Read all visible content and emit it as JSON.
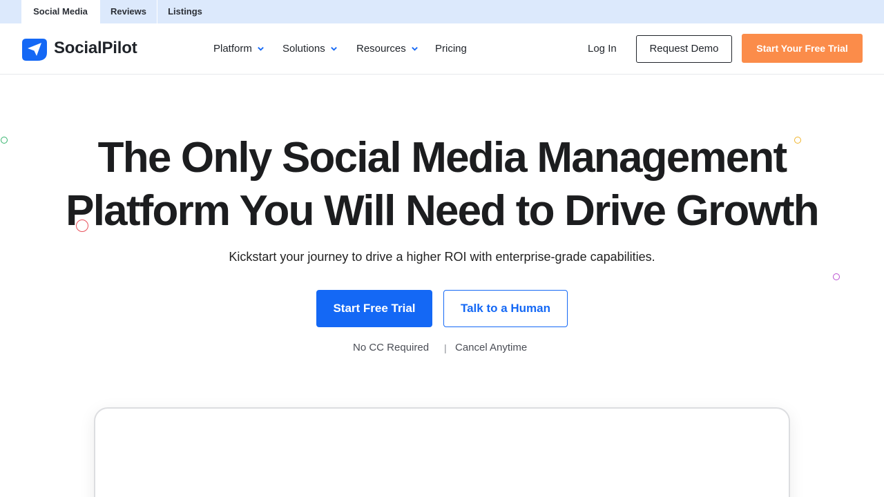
{
  "topbar": {
    "tabs": [
      {
        "label": "Social Media",
        "active": true
      },
      {
        "label": "Reviews",
        "active": false
      },
      {
        "label": "Listings",
        "active": false
      }
    ]
  },
  "header": {
    "logo": {
      "text": "SocialPilot",
      "icon": "paper-plane-logo-icon"
    },
    "nav": [
      {
        "label": "Platform",
        "has_dropdown": true
      },
      {
        "label": "Solutions",
        "has_dropdown": true
      },
      {
        "label": "Resources",
        "has_dropdown": true
      },
      {
        "label": "Pricing",
        "has_dropdown": false
      }
    ],
    "login_label": "Log In",
    "demo_label": "Request Demo",
    "trial_label": "Start Your Free Trial"
  },
  "hero": {
    "headline_line1": "The Only Social Media Management",
    "headline_line2": "Platform You Will Need to Drive Growth",
    "subline": "Kickstart your journey to drive a higher ROI with enterprise-grade capabilities.",
    "primary_cta": "Start Free Trial",
    "secondary_cta": "Talk to a Human",
    "notes": [
      "No CC Required",
      "Cancel Anytime"
    ],
    "note_separator": "|"
  },
  "colors": {
    "brand_blue": "#1468f5",
    "accent_orange": "#fb8c4a",
    "topbar_bg": "#dce9fc",
    "decor_green": "#33b36b",
    "decor_yellow": "#f0b429",
    "decor_red": "#e8505b",
    "decor_purple": "#b94fd1"
  }
}
